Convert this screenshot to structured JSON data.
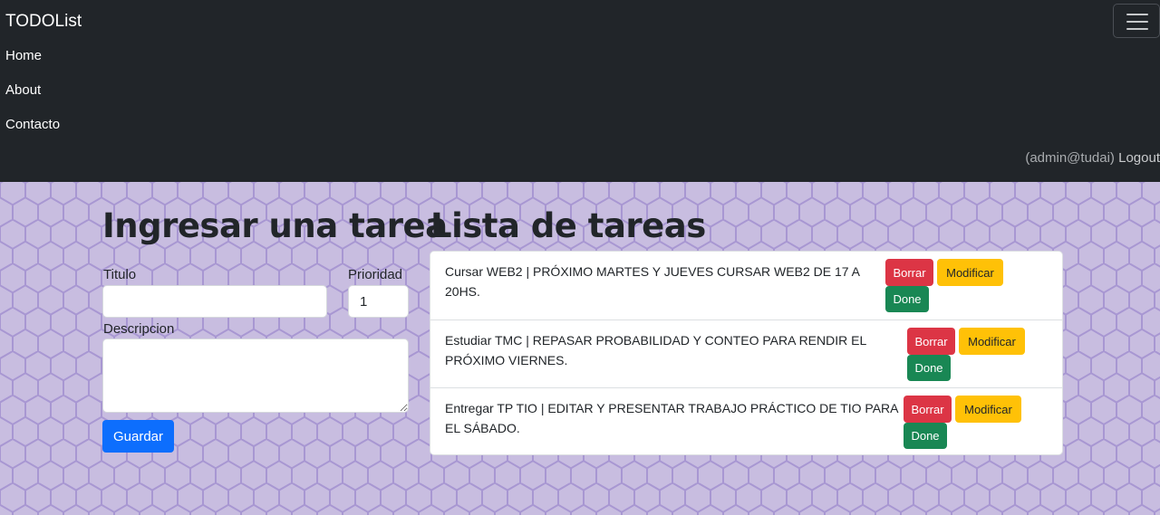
{
  "navbar": {
    "brand": "TODOList",
    "links": [
      {
        "label": "Home"
      },
      {
        "label": "About"
      },
      {
        "label": "Contacto"
      }
    ],
    "user_email": "(admin@tudai)",
    "logout_label": "Logout",
    "toggler_icon": "hamburger-menu-icon"
  },
  "form": {
    "title": "Ingresar una tarea",
    "titulo_label": "Titulo",
    "titulo_value": "",
    "prioridad_label": "Prioridad",
    "prioridad_value": "1",
    "descripcion_label": "Descripcion",
    "descripcion_value": "",
    "submit_label": "Guardar"
  },
  "tasks": {
    "title": "Lista de tareas",
    "items": [
      {
        "line1": "Cursar WEB2 | PRÓXIMO MARTES Y JUEVES CURSAR WEB2 DE 17 A",
        "line2": "20HS.",
        "delete_label": "Borrar",
        "edit_label": "Modificar",
        "done_label": "Done"
      },
      {
        "line1": "Estudiar TMC | REPASAR PROBABILIDAD Y CONTEO PARA RENDIR EL",
        "line2": "PRÓXIMO VIERNES.",
        "delete_label": "Borrar",
        "edit_label": "Modificar",
        "done_label": "Done"
      },
      {
        "line1": "Entregar TP TIO | EDITAR Y PRESENTAR TRABAJO PRÁCTICO DE TIO PARA",
        "line2": "EL SÁBADO.",
        "delete_label": "Borrar",
        "edit_label": "Modificar",
        "done_label": "Done"
      }
    ]
  },
  "colors": {
    "navbar_bg": "#212529",
    "page_bg": "#c8bde0",
    "primary": "#0d6efd",
    "danger": "#dc3545",
    "warning": "#ffc107",
    "success": "#198754"
  }
}
